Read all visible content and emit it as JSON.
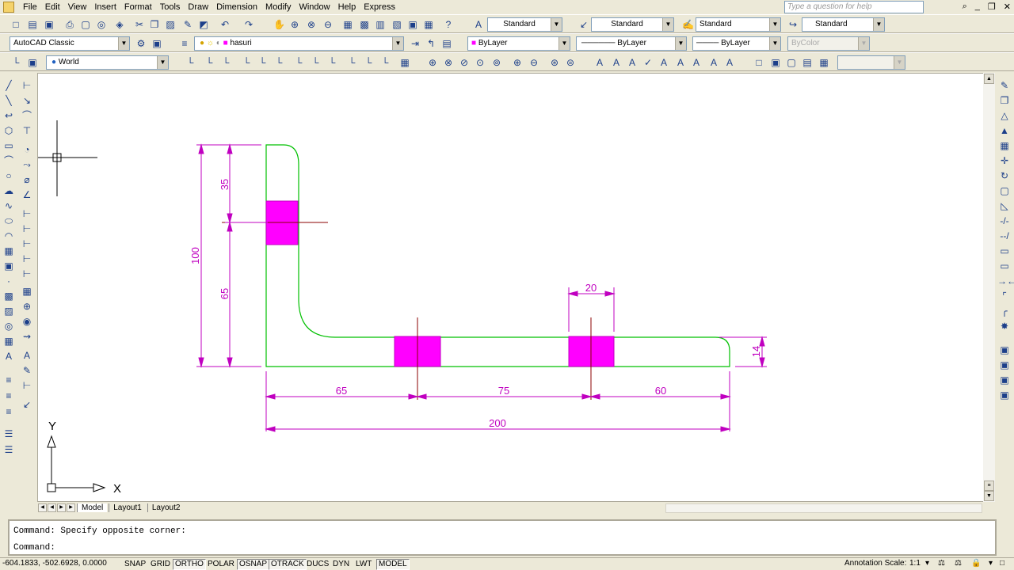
{
  "menu": [
    "File",
    "Edit",
    "View",
    "Insert",
    "Format",
    "Tools",
    "Draw",
    "Dimension",
    "Modify",
    "Window",
    "Help",
    "Express"
  ],
  "help_search": {
    "placeholder": "Type a question for help"
  },
  "toolbars": {
    "text_style": "Standard",
    "dim_style": "Standard",
    "table_style": "Standard",
    "multileader_style": "Standard",
    "workspace": "AutoCAD Classic",
    "layer": "hasuri",
    "color": "ByLayer",
    "linetype": "ByLayer",
    "lineweight": "ByLayer",
    "plot_style": "ByColor",
    "ucs": "World"
  },
  "drawing": {
    "dim_labels": {
      "d35": "35",
      "d65_left": "65",
      "d100": "100",
      "d20": "20",
      "d14": "14",
      "d65_bottom": "65",
      "d75": "75",
      "d60": "60",
      "d200": "200"
    },
    "ucs_x": "X",
    "ucs_y": "Y",
    "colors": {
      "outline": "#00c000",
      "dimension": "#c000c0",
      "fill": "#ff00ff",
      "crosshair": "#000000"
    }
  },
  "tabs": [
    "Model",
    "Layout1",
    "Layout2"
  ],
  "command": {
    "history": "Command: Specify opposite corner:",
    "prompt": "Command:"
  },
  "status": {
    "coords": "-604.1833, -502.6928, 0.0000",
    "buttons": [
      "SNAP",
      "GRID",
      "ORTHO",
      "POLAR",
      "OSNAP",
      "OTRACK",
      "DUCS",
      "DYN",
      "LWT",
      "MODEL"
    ],
    "annotation_scale_label": "Annotation Scale:",
    "annotation_scale_value": "1:1"
  }
}
